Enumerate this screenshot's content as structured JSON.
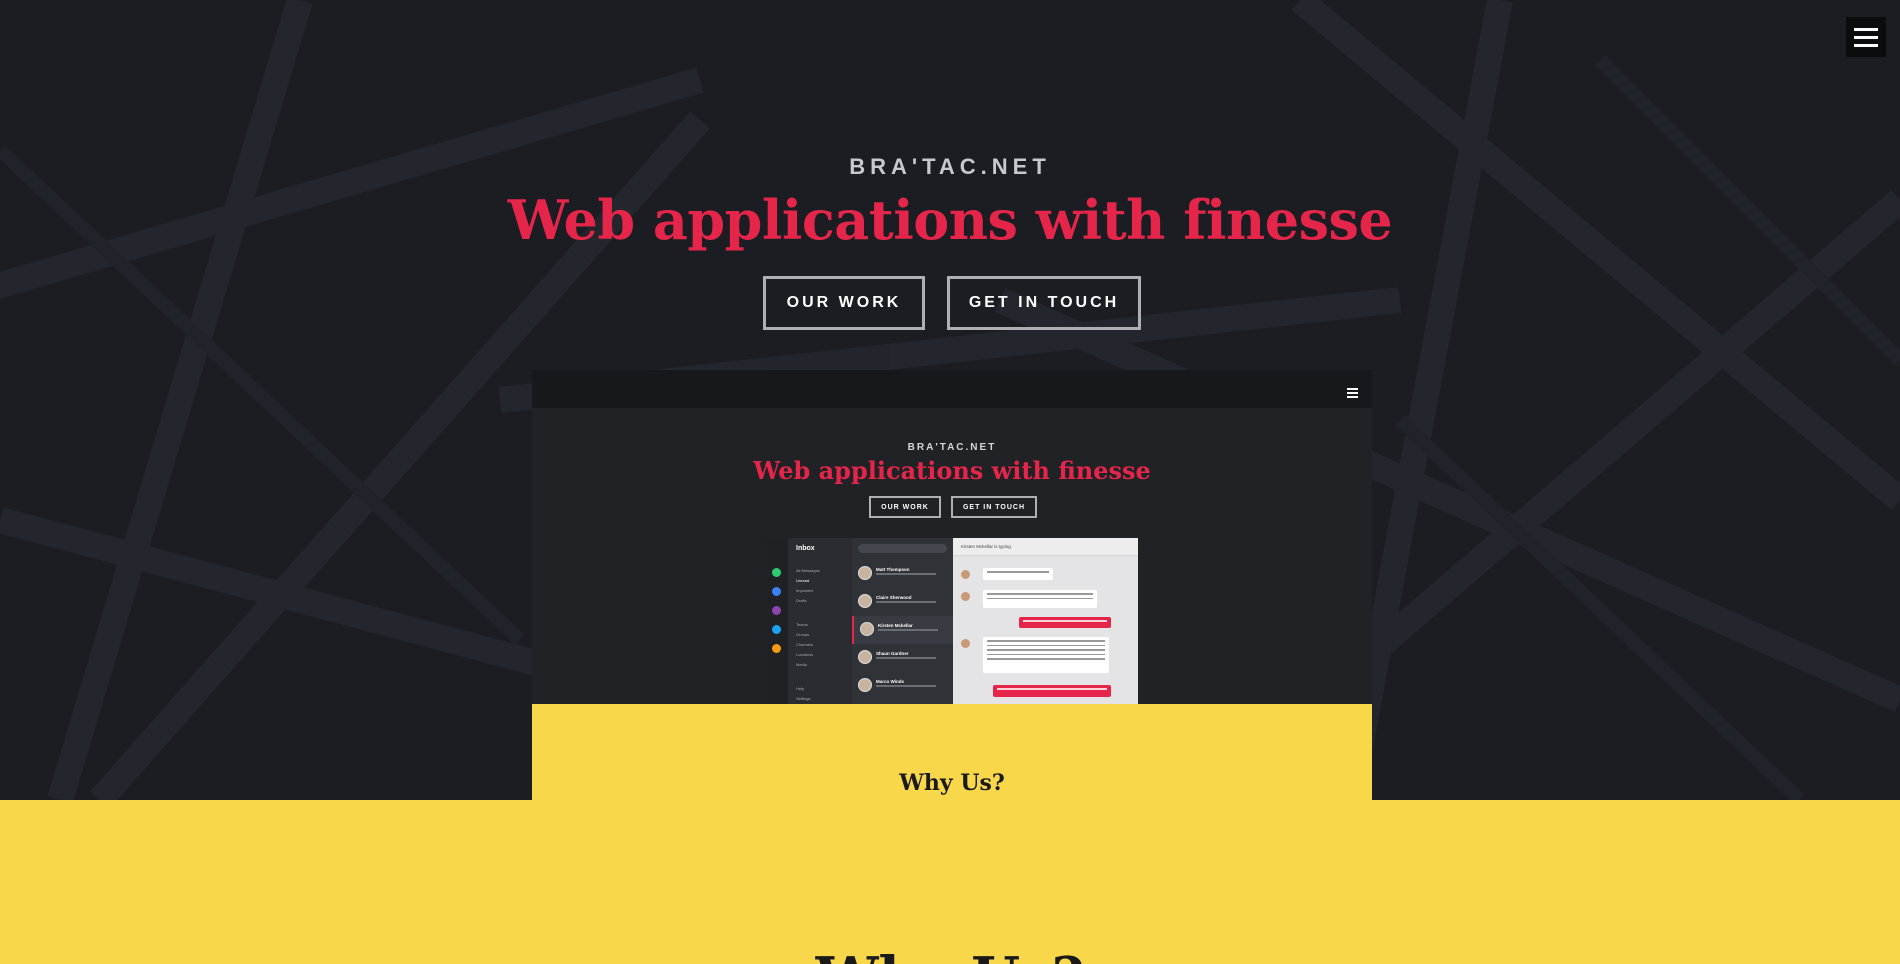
{
  "site": {
    "brand": "BRA'TAC.NET",
    "headline": "Web applications with finesse"
  },
  "nav": {
    "menu_icon": "hamburger-menu-icon"
  },
  "buttons": {
    "our_work": "OUR WORK",
    "get_in_touch": "GET IN TOUCH"
  },
  "preview": {
    "brand": "BRA'TAC.NET",
    "headline": "Web applications with finesse",
    "our_work": "OUR WORK",
    "get_in_touch": "GET IN TOUCH",
    "app": {
      "folder_title": "Inbox",
      "folders": [
        "All Messages",
        "Unread",
        "Important",
        "Drafts",
        "Teams",
        "Groups",
        "Channels",
        "Locations",
        "Media",
        "Help",
        "Settings"
      ],
      "conversations": [
        "Matt Thompson",
        "Claire Sherwood",
        "Kirsten Mckellar",
        "Shaun Gardner",
        "Marco Winds"
      ],
      "chat_header": "Kirsten Mckellar is typing"
    }
  },
  "sections": {
    "why_us_small": "Why Us?",
    "why_us_big": "Why Us?"
  },
  "colors": {
    "background": "#1b1d23",
    "accent_red": "#e5264a",
    "accent_yellow": "#f8d84a",
    "brand_gray": "#c8c9cc"
  }
}
